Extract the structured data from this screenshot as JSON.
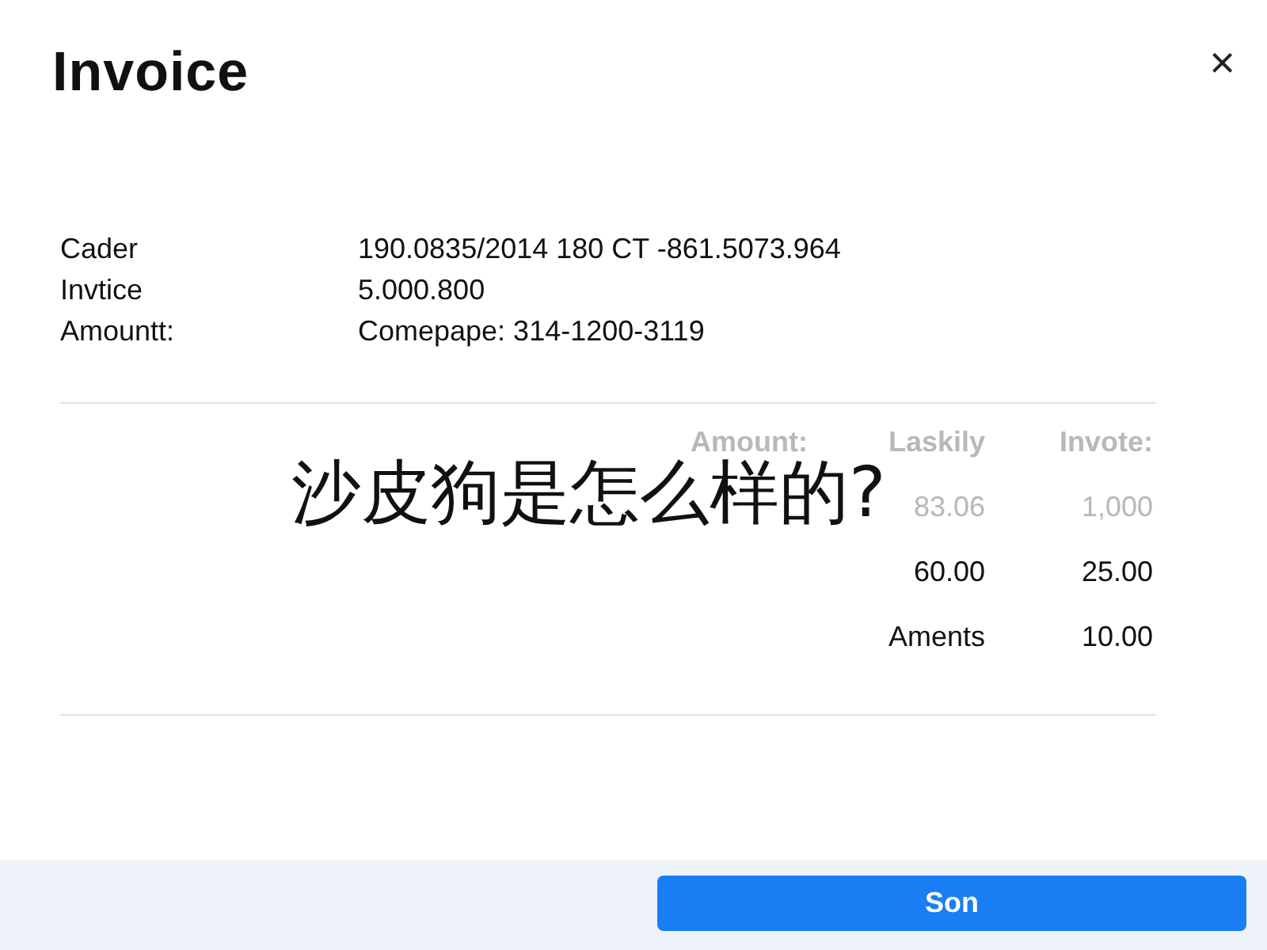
{
  "dialog": {
    "title": "Invoice",
    "close": "×"
  },
  "summary": [
    {
      "label": "Cader",
      "value": "190.0835/2014 180 CT -861.5073.964"
    },
    {
      "label": "Invtice",
      "value": "5.000.800"
    },
    {
      "label": "Amountt:",
      "value": "Comepape: 314-1200-3119"
    }
  ],
  "table": {
    "columns": [
      "Amount:",
      "Laskily",
      "Invote:"
    ],
    "rows": [
      {
        "muted": true,
        "cells": [
          "",
          "83.06",
          "1,000"
        ]
      },
      {
        "muted": false,
        "cells": [
          "",
          "60.00",
          "25.00"
        ]
      },
      {
        "muted": false,
        "cells": [
          "",
          "Aments",
          "10.00"
        ]
      }
    ]
  },
  "caption": "沙皮狗是怎么样的?",
  "footer": {
    "button": "Son"
  }
}
